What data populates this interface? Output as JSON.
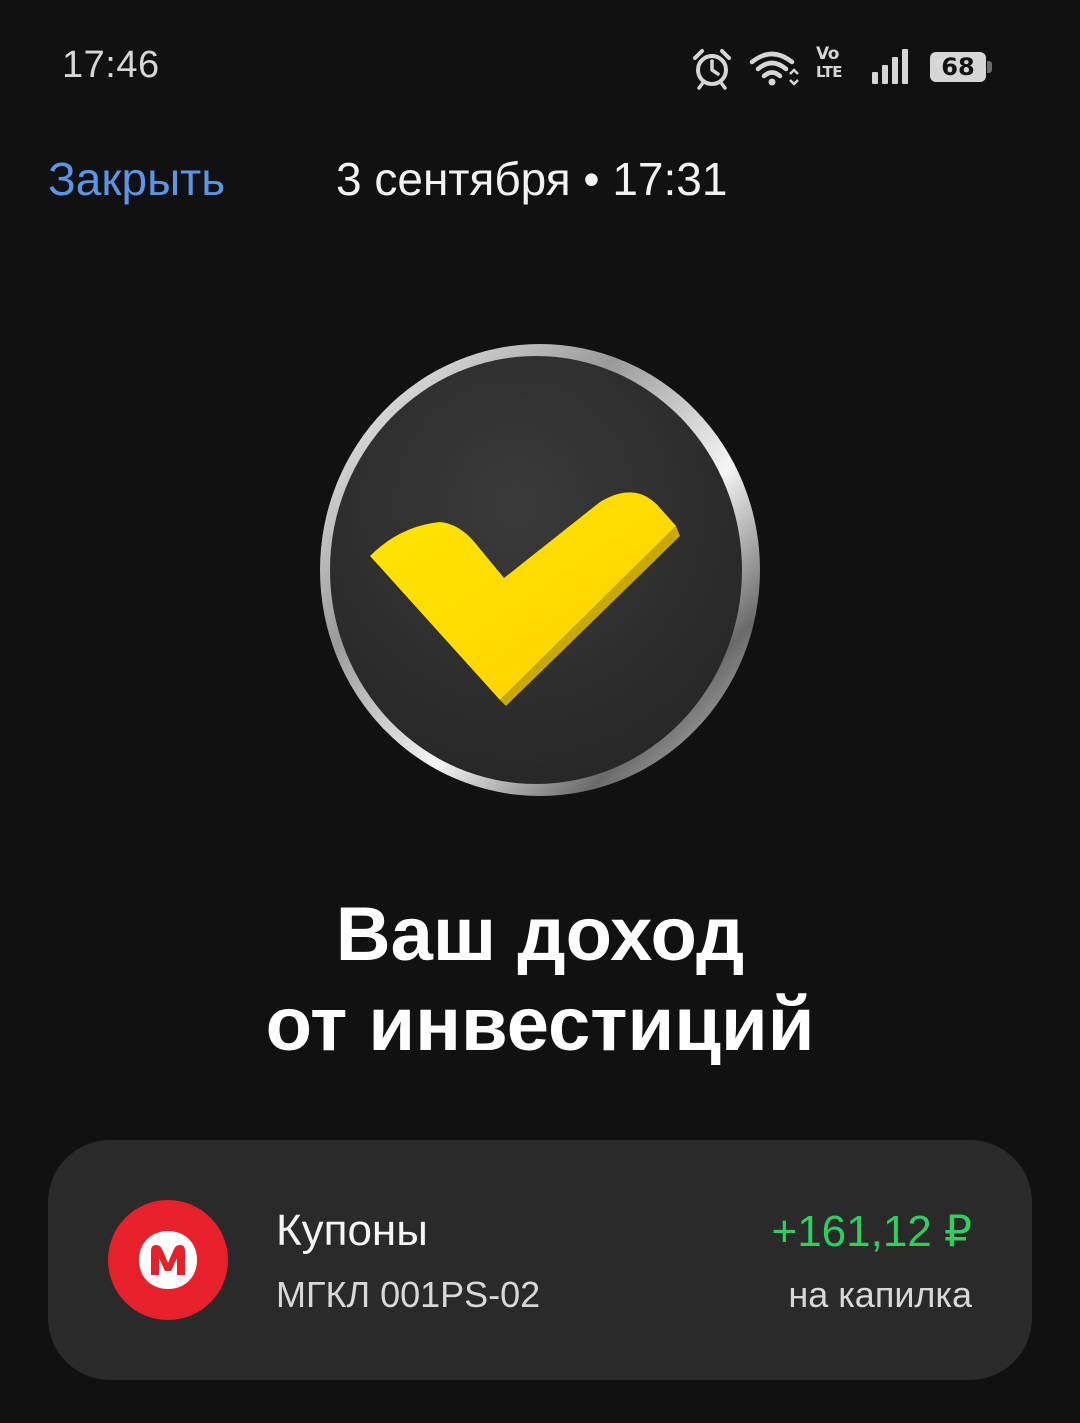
{
  "status_bar": {
    "time": "17:46",
    "battery_level": "68",
    "volte_top": "Vo",
    "volte_bottom": "LTE",
    "icons": [
      "alarm-icon",
      "wifi-icon",
      "volte-icon",
      "signal-icon",
      "battery-icon"
    ]
  },
  "header": {
    "close_label": "Закрыть",
    "date": "3 сентября • 17:31",
    "close_color": "#5b95e8"
  },
  "hero": {
    "icon": "checkmark-coin-icon",
    "accent_color": "#ffe11a"
  },
  "heading": {
    "line1": "Ваш доход",
    "line2": "от инвестиций"
  },
  "income": {
    "title": "Купоны",
    "instrument": "МГКЛ 001PS-02",
    "amount": "+161,12 ₽",
    "destination": "на капилка",
    "logo_letter": "M",
    "logo_color": "#e8202a",
    "amount_color": "#2bd05e"
  }
}
